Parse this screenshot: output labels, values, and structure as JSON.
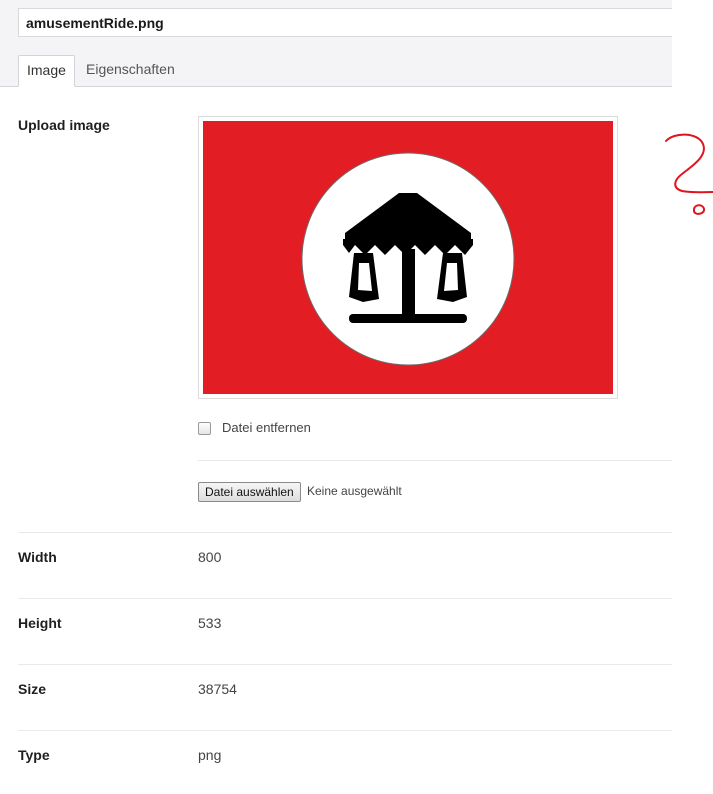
{
  "file": {
    "name": "amusementRide.png"
  },
  "tabs": [
    {
      "label": "Image",
      "active": true
    },
    {
      "label": "Eigenschaften",
      "active": false
    }
  ],
  "upload": {
    "label": "Upload image",
    "preview_bg_color": "#e21e24",
    "remove_checkbox_label": "Datei entfernen",
    "remove_checked": false,
    "choose_button_label": "Datei auswählen",
    "choose_status": "Keine ausgewählt"
  },
  "fields": {
    "width": {
      "label": "Width",
      "value": "800"
    },
    "height": {
      "label": "Height",
      "value": "533"
    },
    "size": {
      "label": "Size",
      "value": "38754"
    },
    "type": {
      "label": "Type",
      "value": "png"
    }
  },
  "icons": {
    "preview": "carousel-icon",
    "annotation": "question-mark-scribble"
  },
  "annotation_color": "#e0141e"
}
